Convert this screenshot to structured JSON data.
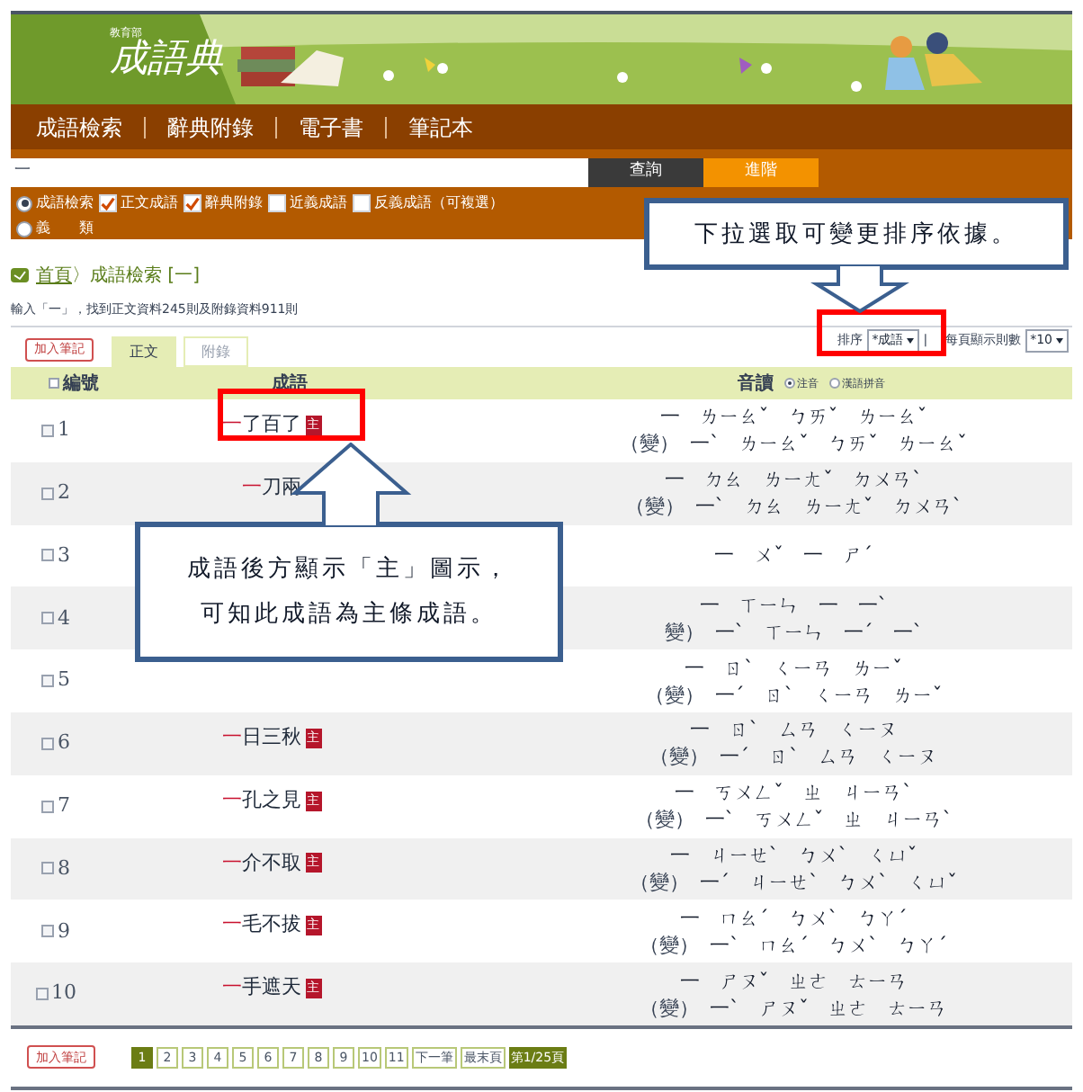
{
  "logo": {
    "ministry": "教育部",
    "title": "成語典"
  },
  "nav": [
    {
      "label": "成語檢索"
    },
    {
      "label": "辭典附錄"
    },
    {
      "label": "電子書"
    },
    {
      "label": "筆記本"
    }
  ],
  "search": {
    "value": "一",
    "buttons": [
      {
        "label": "查詢",
        "kind": "primary"
      },
      {
        "label": "進階",
        "kind": "advanced"
      }
    ]
  },
  "options": [
    {
      "kind": "radio",
      "label": "成語檢索",
      "selected": true
    },
    {
      "kind": "checkbox",
      "label": "正文成語",
      "checked": true
    },
    {
      "kind": "checkbox",
      "label": "辭典附錄",
      "checked": true
    },
    {
      "kind": "checkbox",
      "label": "近義成語",
      "checked": false
    },
    {
      "kind": "checkbox",
      "label": "反義成語（可複選）",
      "checked": false
    }
  ],
  "options_row2": [
    {
      "kind": "radio",
      "label": "義　　類",
      "selected": false
    }
  ],
  "breadcrumb": {
    "home": "首頁",
    "path": "〉成語檢索 [一]"
  },
  "summary": "輸入「一」，找到正文資料245則及附錄資料911則",
  "add_note": "加入筆記",
  "tabs": [
    {
      "label": "正文",
      "selected": true
    },
    {
      "label": "附錄",
      "selected": false
    }
  ],
  "sort": {
    "label": "排序",
    "value": "*成語",
    "separator": "|",
    "per_page_label": "每頁顯示則數",
    "per_page_value": "*10"
  },
  "table": {
    "columns": [
      {
        "label": "編號",
        "checked": false
      },
      {
        "label": "成語"
      },
      {
        "label": "音讀"
      }
    ],
    "reading_modes": [
      {
        "label": "注音",
        "selected": true
      },
      {
        "label": "漢語拼音",
        "selected": false
      }
    ],
    "rows": [
      {
        "number": "1",
        "checked": false,
        "idiom": {
          "head": "一",
          "rest": "了百了",
          "badge": "主"
        },
        "reading": "一　ㄌㄧㄠˇ　ㄅㄞˇ　ㄌㄧㄠˇ",
        "variant_label": "（變）",
        "variant": "一ˋ　ㄌㄧㄠˇ　ㄅㄞˇ　ㄌㄧㄠˇ"
      },
      {
        "number": "2",
        "checked": false,
        "idiom": {
          "head": "一",
          "rest": "刀兩"
        },
        "reading": "一　ㄉㄠ　ㄌㄧㄤˇ　ㄉㄨㄢˋ",
        "variant_label": "（變）",
        "variant": "一ˋ　ㄉㄠ　ㄌㄧㄤˇ　ㄉㄨㄢˋ"
      },
      {
        "number": "3",
        "checked": false,
        "reading": "一　ㄨˇ　一　ㄕˊ"
      },
      {
        "number": "4",
        "checked": false,
        "reading": "一　ㄒㄧㄣ　一　一ˋ",
        "variant_label": "變）",
        "variant": "一ˋ　ㄒㄧㄣ　一ˊ　一ˋ"
      },
      {
        "number": "5",
        "checked": false,
        "reading": "一　ㄖˋ　ㄑㄧㄢ　ㄌㄧˇ",
        "variant_label": "（變）",
        "variant": "一ˊ　ㄖˋ　ㄑㄧㄢ　ㄌㄧˇ"
      },
      {
        "number": "6",
        "checked": false,
        "idiom": {
          "head": "一",
          "rest": "日三秋",
          "badge": "主"
        },
        "reading": "一　ㄖˋ　ㄙㄢ　ㄑㄧㄡ",
        "variant_label": "（變）",
        "variant": "一ˊ　ㄖˋ　ㄙㄢ　ㄑㄧㄡ"
      },
      {
        "number": "7",
        "checked": false,
        "idiom": {
          "head": "一",
          "rest": "孔之見",
          "badge": "主"
        },
        "reading": "一　ㄎㄨㄥˇ　ㄓ　ㄐㄧㄢˋ",
        "variant_label": "（變）",
        "variant": "一ˋ　ㄎㄨㄥˇ　ㄓ　ㄐㄧㄢˋ"
      },
      {
        "number": "8",
        "checked": false,
        "idiom": {
          "head": "一",
          "rest": "介不取",
          "badge": "主"
        },
        "reading": "一　ㄐㄧㄝˋ　ㄅㄨˋ　ㄑㄩˇ",
        "variant_label": "（變）",
        "variant": "一ˊ　ㄐㄧㄝˋ　ㄅㄨˋ　ㄑㄩˇ"
      },
      {
        "number": "9",
        "checked": false,
        "idiom": {
          "head": "一",
          "rest": "毛不拔",
          "badge": "主"
        },
        "reading": "一　ㄇㄠˊ　ㄅㄨˋ　ㄅㄚˊ",
        "variant_label": "（變）",
        "variant": "一ˋ　ㄇㄠˊ　ㄅㄨˋ　ㄅㄚˊ"
      },
      {
        "number": "10",
        "checked": false,
        "idiom": {
          "head": "一",
          "rest": "手遮天",
          "badge": "主"
        },
        "reading": "一　ㄕㄡˇ　ㄓㄜ　ㄊㄧㄢ",
        "variant_label": "（變）",
        "variant": "一ˋ　ㄕㄡˇ　ㄓㄜ　ㄊㄧㄢ"
      }
    ]
  },
  "footer": {
    "add_note": "加入筆記",
    "pages": [
      {
        "label": "1",
        "selected": true
      },
      {
        "label": "2",
        "selected": false
      },
      {
        "label": "3",
        "selected": false
      },
      {
        "label": "4",
        "selected": false
      },
      {
        "label": "5",
        "selected": false
      },
      {
        "label": "6",
        "selected": false
      },
      {
        "label": "7",
        "selected": false
      },
      {
        "label": "8",
        "selected": false
      },
      {
        "label": "9",
        "selected": false
      },
      {
        "label": "10",
        "selected": false
      },
      {
        "label": "11",
        "selected": false
      }
    ],
    "next": "下一筆",
    "last": "最末頁",
    "status": "第1/25頁"
  },
  "callouts": [
    {
      "lines": [
        "下拉選取可變更排序依據。"
      ]
    },
    {
      "lines": [
        "成語後方顯示「主」圖示，",
        "可知此成語為主條成語。"
      ]
    }
  ]
}
